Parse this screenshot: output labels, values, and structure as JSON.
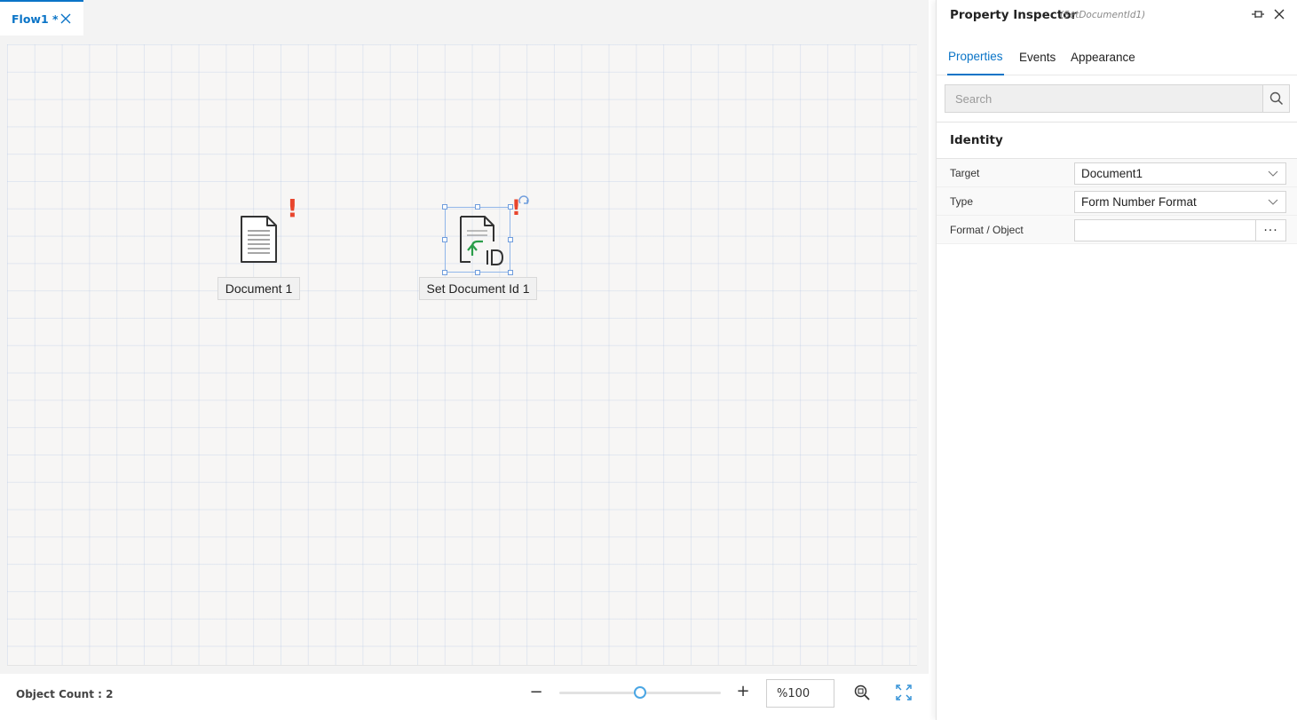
{
  "tab": {
    "title": "Flow1 *"
  },
  "canvas": {
    "nodes": [
      {
        "label": "Document 1",
        "icon": "document-icon",
        "warning": "!"
      },
      {
        "label": "Set Document Id 1",
        "icon": "set-document-id-icon",
        "warning": "!"
      }
    ]
  },
  "statusbar": {
    "object_count": "Object Count : 2",
    "zoom_minus": "−",
    "zoom_plus": "+",
    "zoom_value": "%100",
    "zoom_level": 0.5
  },
  "inspector": {
    "title": "Property Inspector",
    "subtitle": "(SetDocumentId1)",
    "tabs": [
      {
        "label": "Properties",
        "active": true
      },
      {
        "label": "Events",
        "active": false
      },
      {
        "label": "Appearance",
        "active": false
      }
    ],
    "search_placeholder": "Search",
    "section": "Identity",
    "properties": [
      {
        "label": "Target",
        "value": "Document1",
        "kind": "select"
      },
      {
        "label": "Type",
        "value": "Form Number Format",
        "kind": "select"
      },
      {
        "label": "Format / Object",
        "value": "",
        "kind": "ellipsis",
        "button": "···"
      }
    ]
  },
  "colors": {
    "accent": "#0a74c7",
    "warning": "#e8452d",
    "selection": "#93b8ea",
    "id_arrow": "#2a9d4a"
  }
}
